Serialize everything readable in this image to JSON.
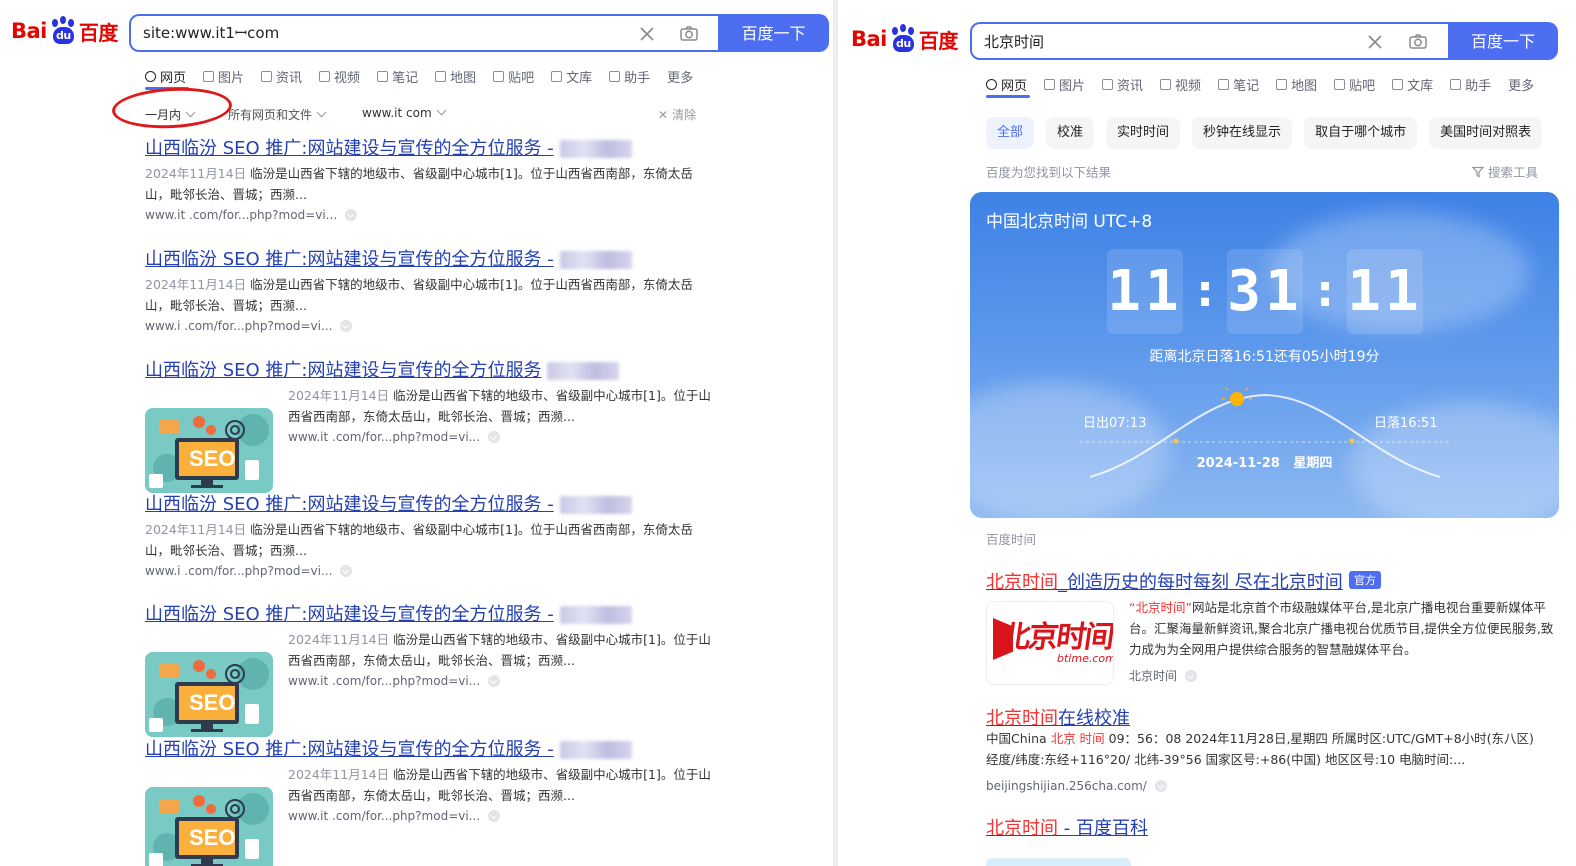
{
  "left": {
    "search": {
      "value": "site:www.it1ꟷcom",
      "button": "百度一下"
    },
    "tabs": [
      "网页",
      "图片",
      "资讯",
      "视频",
      "笔记",
      "地图",
      "贴吧",
      "文库",
      "助手",
      "更多"
    ],
    "filters": {
      "time": "一月内",
      "files": "所有网页和文件",
      "site": "www.it com",
      "clear": "清除"
    },
    "results": [
      {
        "title": "山西临汾 SEO 推广:网站建设与宣传的全方位服务 -",
        "date": "2024年11月14日",
        "snippet": "临汾是山西省下辖的地级市、省级副中心城市[1]。位于山西省西南部，东倚太岳山，毗邻长治、晋城；西濒...",
        "url": "www.it      .com/for...php?mod=vi..."
      },
      {
        "title": "山西临汾 SEO 推广:网站建设与宣传的全方位服务 -",
        "date": "2024年11月14日",
        "snippet": "临汾是山西省下辖的地级市、省级副中心城市[1]。位于山西省西南部，东倚太岳山，毗邻长治、晋城；西濒...",
        "url": "www.i      .com/for...php?mod=vi..."
      },
      {
        "title": "山西临汾 SEO 推广:网站建设与宣传的全方位服务",
        "date": "2024年11月14日",
        "snippet": "临汾是山西省下辖的地级市、省级副中心城市[1]。位于山西省西南部，东倚太岳山，毗邻长治、晋城；西濒...",
        "url": "www.it      .com/for...php?mod=vi..."
      },
      {
        "title": "山西临汾 SEO 推广:网站建设与宣传的全方位服务 -",
        "date": "2024年11月14日",
        "snippet": "临汾是山西省下辖的地级市、省级副中心城市[1]。位于山西省西南部，东倚太岳山，毗邻长治、晋城；西濒...",
        "url": "www.i      .com/for...php?mod=vi..."
      },
      {
        "title": "山西临汾 SEO 推广:网站建设与宣传的全方位服务 -",
        "date": "2024年11月14日",
        "snippet": "临汾是山西省下辖的地级市、省级副中心城市[1]。位于山西省西南部，东倚太岳山，毗邻长治、晋城；西濒...",
        "url": "www.it      .com/for...php?mod=vi..."
      },
      {
        "title": "山西临汾 SEO 推广:网站建设与宣传的全方位服务 -",
        "date": "2024年11月14日",
        "snippet": "临汾是山西省下辖的地级市、省级副中心城市[1]。位于山西省西南部，东倚太岳山，毗邻长治、晋城；西濒...",
        "url": "www.it      .com/for...php?mod=vi..."
      }
    ],
    "seo_label": "SEO"
  },
  "right": {
    "search": {
      "value": "北京时间",
      "button": "百度一下"
    },
    "tabs": [
      "网页",
      "图片",
      "资讯",
      "视频",
      "笔记",
      "地图",
      "贴吧",
      "文库",
      "助手",
      "更多"
    ],
    "chips": [
      "全部",
      "校准",
      "实时时间",
      "秒钟在线显示",
      "取自于哪个城市",
      "美国时间对照表"
    ],
    "found_text": "百度为您找到以下结果",
    "tools": "搜索工具",
    "clock": {
      "title": "中国北京时间 UTC+8",
      "hh": "11",
      "mm": "31",
      "ss": "11",
      "sunset_note": "距离北京日落16:51还有05小时19分",
      "sunrise": "日出07:13",
      "sunset": "日落16:51",
      "date": "2024-11-28",
      "weekday": "星期四"
    },
    "source": "百度时间",
    "r1": {
      "title_em": "北京时间",
      "title_rest": "_创造历史的每时每刻 尽在北京时间",
      "badge": "官方",
      "quote": "“北京时间”",
      "body": "网站是北京首个市级融媒体平台,是北京广播电视台重要新媒体平台。汇聚海量新鲜资讯,聚合北京广播电视台优质节目,提供全方位便民服务,致力成为为全网用户提供综合服务的智慧融媒体平台。",
      "site": "北京时间",
      "logo_cn": "北京时间",
      "logo_en": "btime.com"
    },
    "r2": {
      "title_em": "北京时间",
      "title_rest": "在线校准",
      "pre": "中国China ",
      "em": "北京 时间",
      "body": " 09：56：08 2024年11月28日,星期四 所属时区:UTC/GMT+8小时(东八区) 经度/纬度:东经+116°20/ 北纬-39°56 国家区号:+86(中国) 地区区号:10 电脑时间:...",
      "url": "beijingshijian.256cha.com/"
    },
    "r3": {
      "title_em": "北京时间",
      "title_rest": " - 百度百科"
    }
  },
  "brand": {
    "logo_bai": "Bai",
    "logo_du": "du",
    "logo_cn": "百度"
  },
  "colors": {
    "accent": "#4e6ef2",
    "link": "#2440b3",
    "red": "#e10601"
  }
}
